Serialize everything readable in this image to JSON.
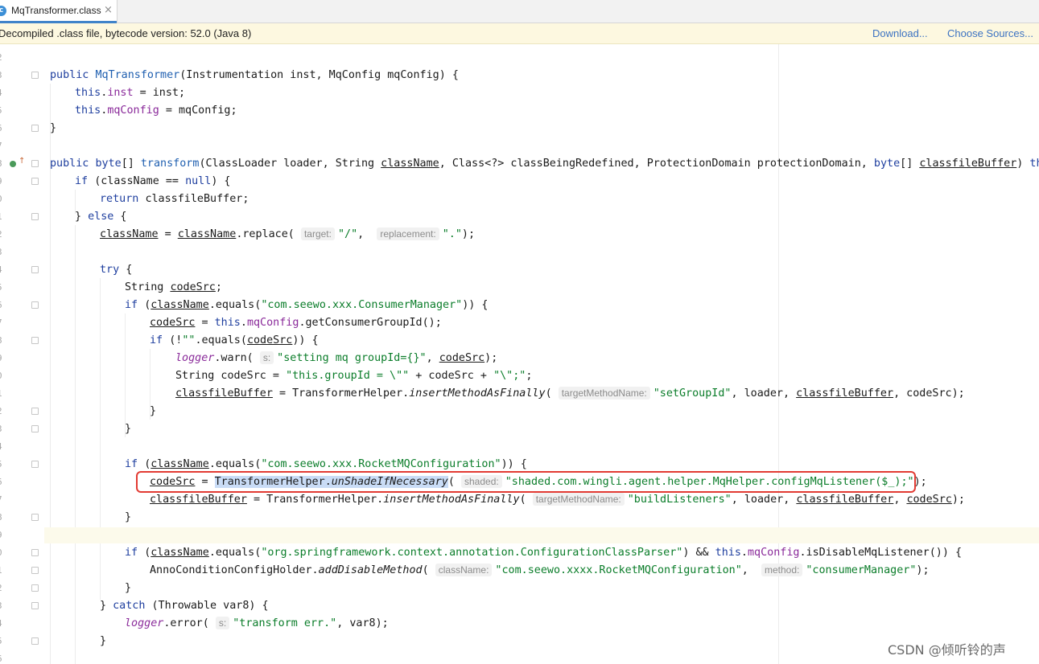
{
  "tab": {
    "label": "MqTransformer.class",
    "icon_letter": "c",
    "close": "×"
  },
  "banner": {
    "message": "Decompiled .class file, bytecode version: 52.0 (Java 8)",
    "download": "Download...",
    "choose_sources": "Choose Sources..."
  },
  "line_numbers": [
    "2",
    "3",
    "4",
    "5",
    "6",
    "7",
    "8",
    "9",
    "0",
    "1",
    "2",
    "3",
    "4",
    "5",
    "6",
    "7",
    "8",
    "9",
    "0",
    "1",
    "2",
    "3",
    "4",
    "5",
    "6",
    "7",
    "8",
    "9",
    "0",
    "1",
    "2",
    "3",
    "4",
    "5",
    "6"
  ],
  "watermark": "CSDN @倾听铃的声",
  "code": {
    "l03": {
      "a": "public ",
      "b": "MqTransformer",
      "c": "(Instrumentation inst, MqConfig mqConfig) {"
    },
    "l04": {
      "a": "this",
      "b": ".",
      "c": "inst",
      "d": " = inst;"
    },
    "l05": {
      "a": "this",
      "b": ".",
      "c": "mqConfig",
      "d": " = mqConfig;"
    },
    "l06": {
      "a": "}"
    },
    "l08": {
      "a": "public ",
      "b": "byte",
      "c": "[] ",
      "d": "transform",
      "e": "(ClassLoader loader, String ",
      "f": "className",
      "g": ", Class<?> classBeingRedefined, ProtectionDomain protectionDomain, ",
      "h": "byte",
      "i": "[] ",
      "j": "classfileBuffer",
      "k": ") ",
      "l": "throws"
    },
    "l09": {
      "a": "if ",
      "b": "(className == ",
      "c": "null",
      "d": ") {"
    },
    "l10": {
      "a": "return ",
      "b": "classfileBuffer;"
    },
    "l11": {
      "a": "} ",
      "b": "else",
      "c": " {"
    },
    "l12": {
      "a": "className",
      "b": " = ",
      "c": "className",
      "d": ".replace( ",
      "e": "target:",
      "f": "\"/\"",
      "g": ",  ",
      "h": "replacement:",
      "i": "\".\"",
      "j": ");"
    },
    "l14": {
      "a": "try",
      "b": " {"
    },
    "l15": {
      "a": "String ",
      "b": "codeSrc",
      "c": ";"
    },
    "l16": {
      "a": "if ",
      "b": "(",
      "c": "className",
      "d": ".equals(",
      "e": "\"com.seewo.xxx.ConsumerManager\"",
      "f": ")) {"
    },
    "l17": {
      "a": "codeSrc",
      "b": " = ",
      "c": "this",
      "d": ".",
      "e": "mqConfig",
      "f": ".getConsumerGroupId();"
    },
    "l18": {
      "a": "if ",
      "b": "(!",
      "c": "\"\"",
      "d": ".equals(",
      "e": "codeSrc",
      "f": ")) {"
    },
    "l19": {
      "a": "logger",
      "b": ".warn( ",
      "c": "s:",
      "d": "\"setting mq groupId={}\"",
      "e": ", ",
      "f": "codeSrc",
      "g": ");"
    },
    "l20": {
      "a": "String codeSrc = ",
      "b": "\"this.groupId = \\\"\"",
      "c": " + codeSrc + ",
      "d": "\"\\\";\"",
      "e": ";"
    },
    "l21": {
      "a": "classfileBuffer",
      "b": " = TransformerHelper.",
      "c": "insertMethodAsFinally",
      "d": "( ",
      "e": "targetMethodName:",
      "f": "\"setGroupId\"",
      "g": ", loader, ",
      "h": "classfileBuffer",
      "i": ", codeSrc);"
    },
    "l22": {
      "a": "}"
    },
    "l23": {
      "a": "}"
    },
    "l25": {
      "a": "if ",
      "b": "(",
      "c": "className",
      "d": ".equals(",
      "e": "\"com.seewo.xxx.RocketMQConfiguration\"",
      "f": ")) {"
    },
    "l26": {
      "a": "codeSrc",
      "b": " = ",
      "c": "TransformerHelper",
      "d": ".",
      "e": "unShadeIfNecessary",
      "f": "( ",
      "g": "shaded:",
      "h": "\"shaded.com.wingli.agent.helper.MqHelper.configMqListener($_);\"",
      "i": ");"
    },
    "l27": {
      "a": "classfileBuffer",
      "b": " = TransformerHelper.",
      "c": "insertMethodAsFinally",
      "d": "( ",
      "e": "targetMethodName:",
      "f": "\"buildListeners\"",
      "g": ", loader, ",
      "h": "classfileBuffer",
      "i": ", ",
      "j": "codeSrc",
      "k": ");"
    },
    "l28": {
      "a": "}"
    },
    "l30": {
      "a": "if ",
      "b": "(",
      "c": "className",
      "d": ".equals(",
      "e": "\"org.springframework.context.annotation.ConfigurationClassParser\"",
      "f": ") && ",
      "g": "this",
      "h": ".",
      "i": "mqConfig",
      "j": ".isDisableMqListener()) {"
    },
    "l31": {
      "a": "AnnoConditionConfigHolder.",
      "b": "addDisableMethod",
      "c": "( ",
      "d": "className:",
      "e": "\"com.seewo.xxxx.RocketMQConfiguration\"",
      "f": ",  ",
      "g": "method:",
      "h": "\"consumerManager\"",
      "i": ");"
    },
    "l32": {
      "a": "}"
    },
    "l33": {
      "a": "} ",
      "b": "catch",
      "c": " (Throwable var8) {"
    },
    "l34": {
      "a": "logger",
      "b": ".error( ",
      "c": "s:",
      "d": "\"transform err.\"",
      "e": ", var8);"
    },
    "l35": {
      "a": "}"
    }
  }
}
